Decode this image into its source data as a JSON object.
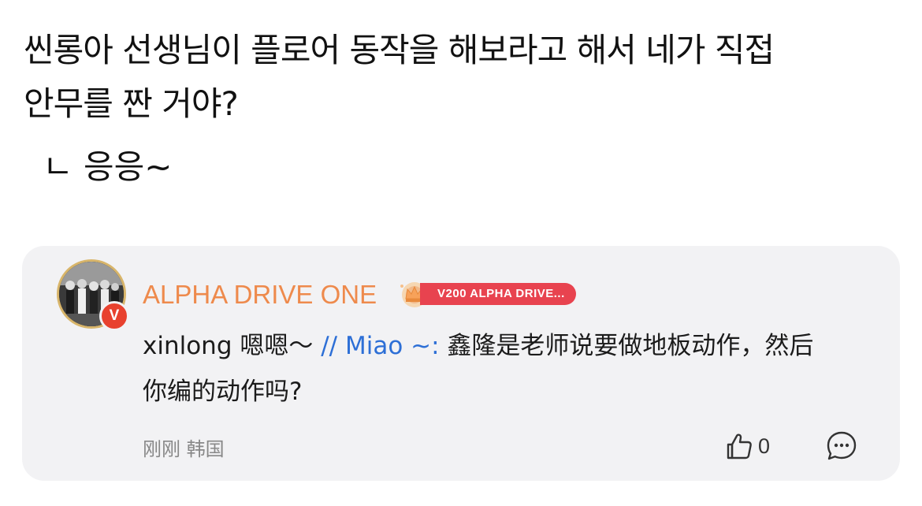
{
  "post": {
    "lines": [
      "씬롱아 선생님이 플로어 동작을 해보라고 해서 네가 직접",
      "안무를 짠 거야?"
    ],
    "reply": "ㄴ 응응~"
  },
  "comment_card": {
    "username": "ALPHA DRIVE ONE",
    "badge": "V200 ALPHA DRIVE...",
    "verified_mark": "V",
    "comment": {
      "author_text": "xinlong 嗯嗯～ ",
      "separator": "// Miao ~:",
      "quoted_text": " 鑫隆是老师说要做地板动作，然后你编的动作吗?"
    },
    "meta": "刚刚 韩国",
    "like_count": "0",
    "icons": {
      "like": "thumbs-up-icon",
      "comment": "comment-bubble-icon",
      "crown": "crown-icon"
    },
    "colors": {
      "username": "#ee8a4c",
      "badge": "#e8434f",
      "mention": "#2d6fd6",
      "verified": "#e8412e"
    }
  }
}
